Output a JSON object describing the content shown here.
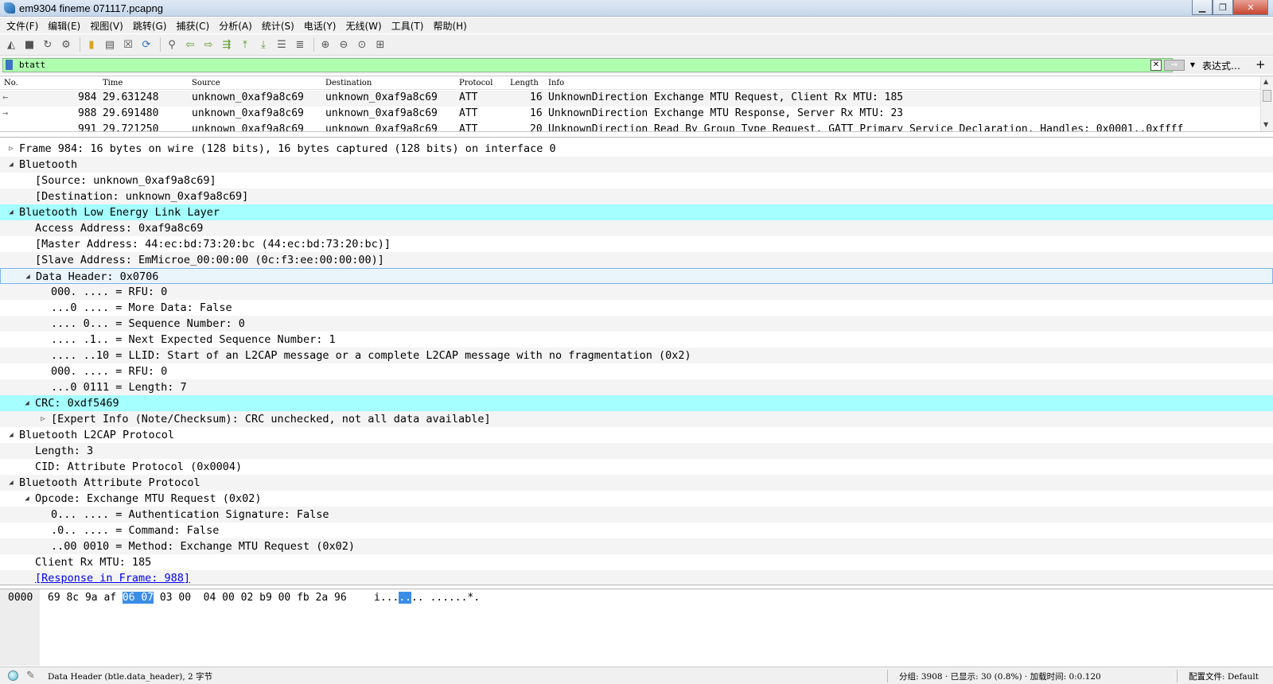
{
  "window": {
    "title": "em9304 fineme 071117.pcapng"
  },
  "menu": [
    "文件(F)",
    "编辑(E)",
    "视图(V)",
    "跳转(G)",
    "捕获(C)",
    "分析(A)",
    "统计(S)",
    "电话(Y)",
    "无线(W)",
    "工具(T)",
    "帮助(H)"
  ],
  "toolbar": [
    "shark-fin-start-icon",
    "stop-icon",
    "restart-icon",
    "capture-options-icon",
    "open-file-icon",
    "save-file-icon",
    "close-file-icon",
    "reload-icon",
    "find-packet-icon",
    "go-back-icon",
    "go-forward-icon",
    "go-to-packet-icon",
    "first-packet-icon",
    "last-packet-icon",
    "auto-scroll-icon",
    "colorize-icon",
    "zoom-in-icon",
    "zoom-out-icon",
    "zoom-reset-icon",
    "resize-columns-icon"
  ],
  "filter": {
    "value": "btatt",
    "expression_label": "表达式…",
    "add_label": "+"
  },
  "packet_list": {
    "columns": [
      "No.",
      "Time",
      "Source",
      "Destination",
      "Protocol",
      "Length",
      "Info"
    ],
    "rows": [
      {
        "arrow": "←",
        "no": "984",
        "time": "29.631248",
        "source": "unknown_0xaf9a8c69",
        "destination": "unknown_0xaf9a8c69",
        "protocol": "ATT",
        "length": "16",
        "info": "UnknownDirection Exchange MTU Request, Client Rx MTU: 185"
      },
      {
        "arrow": "→",
        "no": "988",
        "time": "29.691480",
        "source": "unknown_0xaf9a8c69",
        "destination": "unknown_0xaf9a8c69",
        "protocol": "ATT",
        "length": "16",
        "info": "UnknownDirection Exchange MTU Response, Server Rx MTU: 23"
      },
      {
        "arrow": "",
        "no": "991",
        "time": "29.721250",
        "source": "unknown_0xaf9a8c69",
        "destination": "unknown_0xaf9a8c69",
        "protocol": "ATT",
        "length": "20",
        "info": "UnknownDirection Read By Group Type Request, GATT Primary Service Declaration, Handles: 0x0001..0xffff"
      }
    ]
  },
  "details": [
    {
      "level": 0,
      "twisty": "▷",
      "text": "Frame 984: 16 bytes on wire (128 bits), 16 bytes captured (128 bits) on interface 0"
    },
    {
      "level": 0,
      "twisty": "◢",
      "text": "Bluetooth"
    },
    {
      "level": 1,
      "twisty": "",
      "text": "[Source: unknown_0xaf9a8c69]"
    },
    {
      "level": 1,
      "twisty": "",
      "text": "[Destination: unknown_0xaf9a8c69]"
    },
    {
      "level": 0,
      "twisty": "◢",
      "text": "Bluetooth Low Energy Link Layer",
      "style": "hl"
    },
    {
      "level": 1,
      "twisty": "",
      "text": "Access Address: 0xaf9a8c69"
    },
    {
      "level": 1,
      "twisty": "",
      "text": "[Master Address: 44:ec:bd:73:20:bc (44:ec:bd:73:20:bc)]"
    },
    {
      "level": 1,
      "twisty": "",
      "text": "[Slave Address: EmMicroe_00:00:00 (0c:f3:ee:00:00:00)]"
    },
    {
      "level": 1,
      "twisty": "◢",
      "text": "Data Header: 0x0706",
      "style": "sel"
    },
    {
      "level": 2,
      "twisty": "",
      "text": "000. .... = RFU: 0"
    },
    {
      "level": 2,
      "twisty": "",
      "text": "...0 .... = More Data: False"
    },
    {
      "level": 2,
      "twisty": "",
      "text": ".... 0... = Sequence Number: 0"
    },
    {
      "level": 2,
      "twisty": "",
      "text": ".... .1.. = Next Expected Sequence Number: 1"
    },
    {
      "level": 2,
      "twisty": "",
      "text": ".... ..10 = LLID: Start of an L2CAP message or a complete L2CAP message with no fragmentation (0x2)"
    },
    {
      "level": 2,
      "twisty": "",
      "text": "000. .... = RFU: 0"
    },
    {
      "level": 2,
      "twisty": "",
      "text": "...0 0111 = Length: 7"
    },
    {
      "level": 1,
      "twisty": "◢",
      "text": "CRC: 0xdf5469",
      "style": "hl"
    },
    {
      "level": 2,
      "twisty": "▷",
      "text": "[Expert Info (Note/Checksum): CRC unchecked, not all data available]"
    },
    {
      "level": 0,
      "twisty": "◢",
      "text": "Bluetooth L2CAP Protocol"
    },
    {
      "level": 1,
      "twisty": "",
      "text": "Length: 3"
    },
    {
      "level": 1,
      "twisty": "",
      "text": "CID: Attribute Protocol (0x0004)"
    },
    {
      "level": 0,
      "twisty": "◢",
      "text": "Bluetooth Attribute Protocol"
    },
    {
      "level": 1,
      "twisty": "◢",
      "text": "Opcode: Exchange MTU Request (0x02)"
    },
    {
      "level": 2,
      "twisty": "",
      "text": "0... .... = Authentication Signature: False"
    },
    {
      "level": 2,
      "twisty": "",
      "text": ".0.. .... = Command: False"
    },
    {
      "level": 2,
      "twisty": "",
      "text": "..00 0010 = Method: Exchange MTU Request (0x02)"
    },
    {
      "level": 1,
      "twisty": "",
      "text": "Client Rx MTU: 185"
    },
    {
      "level": 1,
      "twisty": "",
      "text": "[Response in Frame: 988]",
      "style": "link"
    }
  ],
  "bytes": {
    "offset": "0000",
    "hex_before": "69 8c 9a af ",
    "hex_selected": "06 07",
    "hex_after": " 03 00  04 00 02 b9 00 fb 2a 96",
    "ascii_before": "i...",
    "ascii_selected": "..",
    "ascii_after": ".. ......*."
  },
  "status": {
    "field_info": "Data Header (btle.data_header), 2 字节",
    "packets": "分组: 3908 · 已显示: 30 (0.8%) · 加载时间: 0:0.120",
    "profile": "配置文件: Default"
  },
  "colors": {
    "highlight": "#a5ffff",
    "filter_ok": "#afffaf",
    "byte_selection": "#3a8de6"
  }
}
